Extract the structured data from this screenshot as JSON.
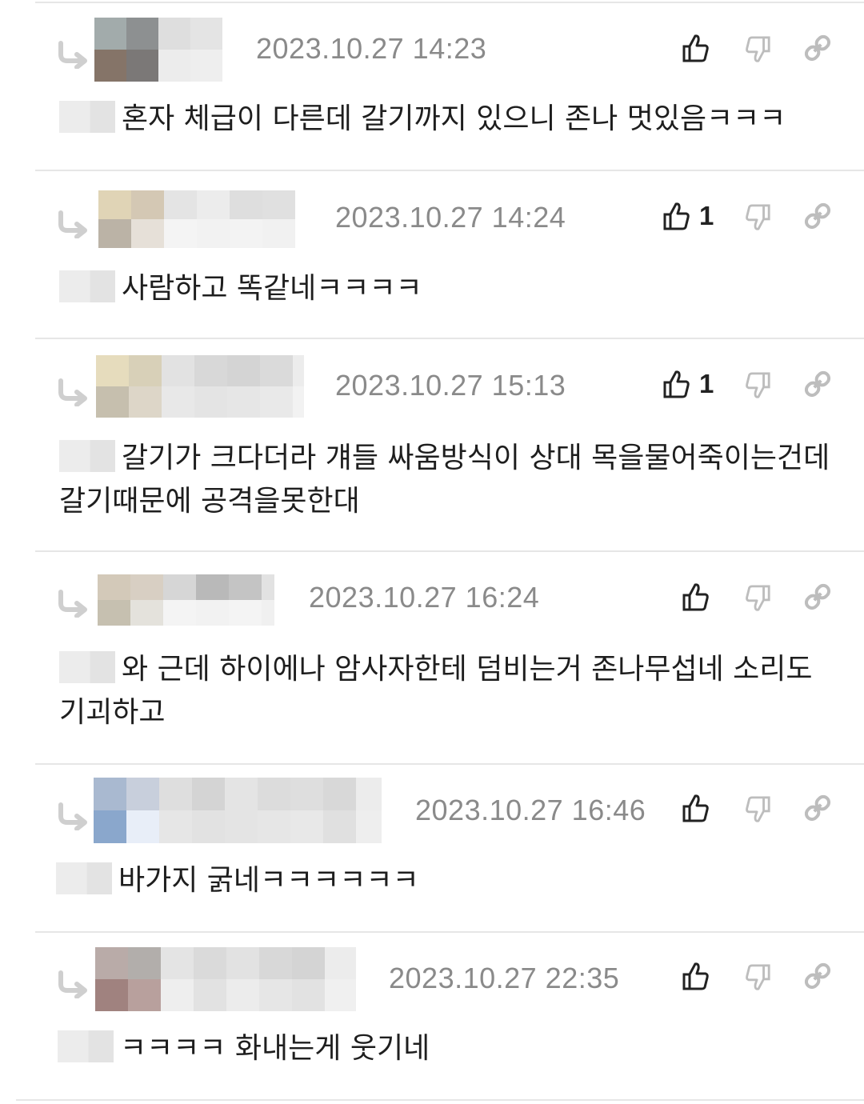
{
  "comments": [
    {
      "date": "2023.10.27 14:23",
      "likes": "",
      "text": "혼자 체급이 다른데 갈기까지 있으니 존나 멋있음ㅋㅋㅋ"
    },
    {
      "date": "2023.10.27 14:24",
      "likes": "1",
      "text": "사람하고 똑같네ㅋㅋㅋㅋ"
    },
    {
      "date": "2023.10.27 15:13",
      "likes": "1",
      "text": "갈기가 크다더라 걔들 싸움방식이 상대 목을물어죽이는건데 갈기때문에 공격을못한대"
    },
    {
      "date": "2023.10.27 16:24",
      "likes": "",
      "text": "와 근데 하이에나 암사자한테 덤비는거 존나무섭네 소리도 기괴하고"
    },
    {
      "date": "2023.10.27 16:46",
      "likes": "",
      "text": "바가지 굵네ㅋㅋㅋㅋㅋㅋ"
    },
    {
      "date": "2023.10.27 22:35",
      "likes": "",
      "text": "ㅋㅋㅋㅋ 화내는게 웃기네"
    }
  ],
  "icons": {
    "reply": "reply-arrow-icon",
    "like": "thumbs-up-icon",
    "dislike": "thumbs-down-icon",
    "link": "link-icon"
  }
}
